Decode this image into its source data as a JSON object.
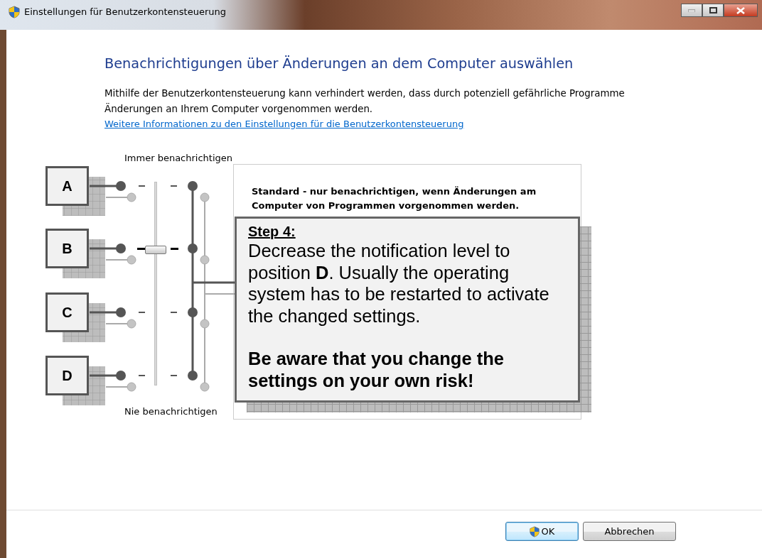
{
  "window": {
    "title": "Einstellungen für Benutzerkontensteuerung"
  },
  "heading": "Benachrichtigungen über Änderungen an dem Computer auswählen",
  "description": "Mithilfe der Benutzerkontensteuerung kann verhindert werden, dass durch potenziell gefährliche Programme Änderungen an Ihrem Computer vorgenommen werden.",
  "link": "Weitere Informationen zu den Einstellungen für die Benutzerkontensteuerung",
  "slider": {
    "top_label": "Immer benachrichtigen",
    "bottom_label": "Nie benachrichtigen",
    "level": 0.667
  },
  "description_box": {
    "text": "Standard - nur benachrichtigen, wenn Änderungen am Computer von Programmen vorgenommen werden."
  },
  "annotation": {
    "markers": [
      "A",
      "B",
      "C",
      "D"
    ],
    "title": "Step 4:",
    "body": "Decrease the notification level to position **D**. Usually the operating system has to be restarted to activate the changed settings.",
    "warning": "Be aware that you change the settings on your own risk!"
  },
  "buttons": [
    {
      "label": "OK",
      "kind": "shield",
      "default": true
    },
    {
      "label": "Abbrechen",
      "kind": "plain",
      "default": false
    }
  ]
}
